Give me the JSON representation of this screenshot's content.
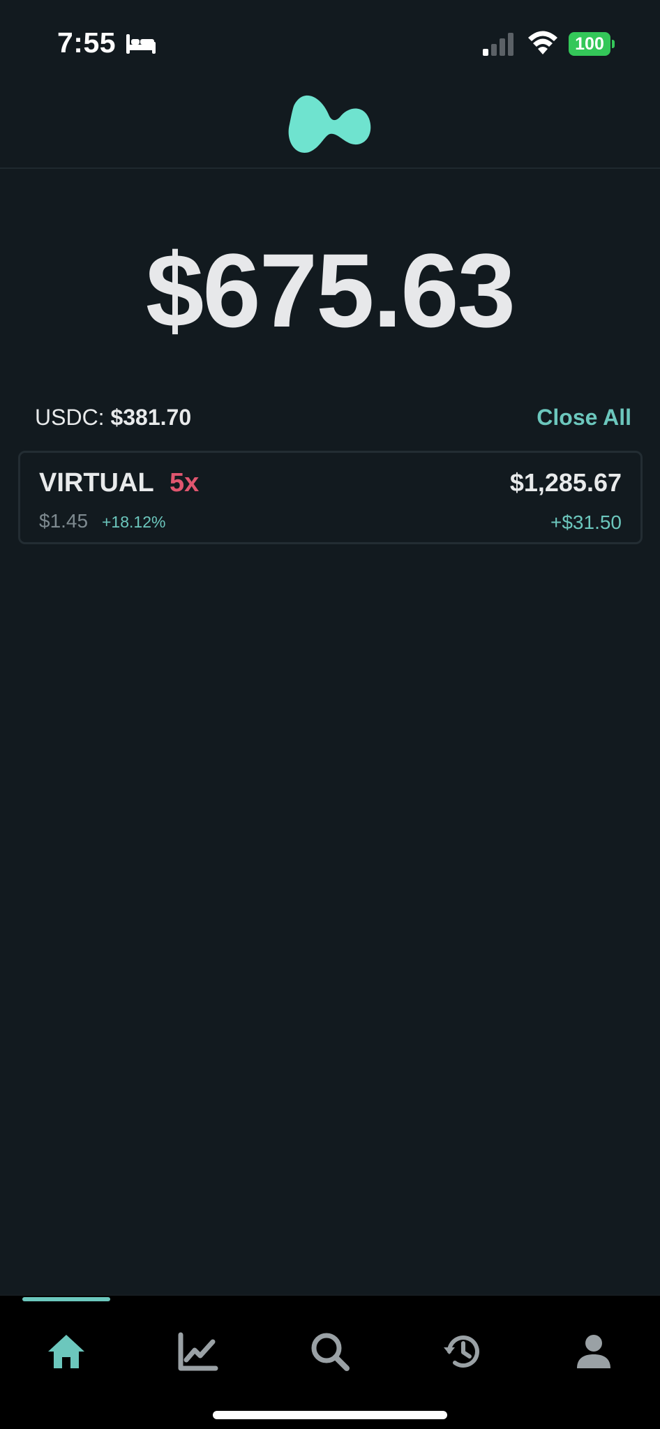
{
  "status_bar": {
    "time": "7:55",
    "battery": "100",
    "icons": [
      "bed-icon",
      "cellular-signal-icon",
      "wifi-icon",
      "battery-icon"
    ]
  },
  "header": {
    "logo_icon": "app-logo-icon",
    "logo_color": "#6fe3cf"
  },
  "portfolio": {
    "total_value": "$675.63"
  },
  "usdc": {
    "label": "USDC:",
    "value": "$381.70"
  },
  "close_all_label": "Close All",
  "positions": [
    {
      "symbol": "VIRTUAL",
      "leverage": "5x",
      "price": "$1.45",
      "change": "+18.12%",
      "value": "$1,285.67",
      "pnl": "+$31.50"
    }
  ],
  "tab_bar": {
    "active": "home",
    "tabs": [
      {
        "icon": "home-icon"
      },
      {
        "icon": "chart-icon"
      },
      {
        "icon": "search-icon"
      },
      {
        "icon": "history-icon"
      },
      {
        "icon": "profile-icon"
      }
    ]
  },
  "colors": {
    "background": "#121a1f",
    "accent": "#6cc7bd",
    "leverage": "#e0566f",
    "battery": "#34c759"
  }
}
